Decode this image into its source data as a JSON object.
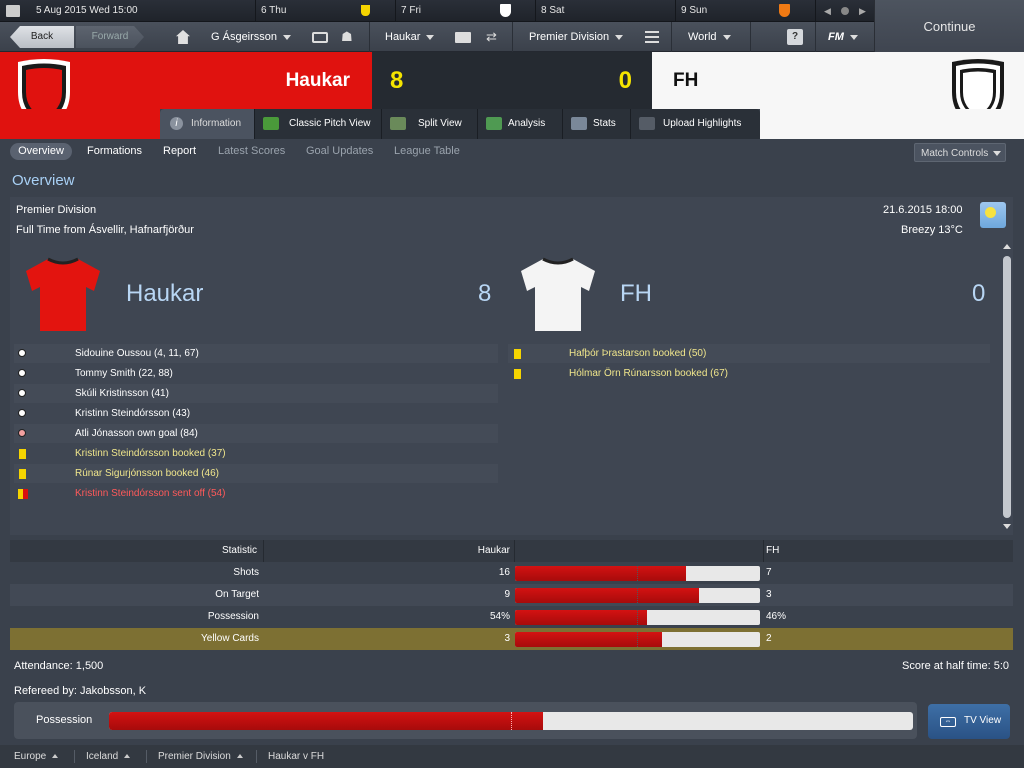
{
  "calendar": {
    "today": "5 Aug 2015  Wed  15:00",
    "days": [
      "6  Thu",
      "7  Fri",
      "8  Sat",
      "9  Sun"
    ]
  },
  "continue_label": "Continue",
  "nav": {
    "back": "Back",
    "forward": "Forward",
    "manager": "G Ásgeirsson",
    "club": "Haukar",
    "competition": "Premier Division",
    "world": "World",
    "help": "?",
    "fm": "FM"
  },
  "match": {
    "home_team": "Haukar",
    "away_team": "FH",
    "home_score": "8",
    "away_score": "0"
  },
  "tabs": [
    "Information",
    "Classic Pitch View",
    "Split View",
    "Analysis",
    "Stats",
    "Upload Highlights"
  ],
  "subtabs": [
    "Overview",
    "Formations",
    "Report",
    "Latest Scores",
    "Goal Updates",
    "League Table"
  ],
  "match_controls": "Match Controls",
  "overview": {
    "title": "Overview",
    "competition": "Premier Division",
    "venue": "Full Time from Ásvellir, Hafnarfjörður",
    "datetime": "21.6.2015 18:00",
    "weather": "Breezy 13°C"
  },
  "home_events": [
    {
      "type": "goal",
      "text": "Sidouine Oussou (4, 11, 67)"
    },
    {
      "type": "goal",
      "text": "Tommy Smith (22, 88)"
    },
    {
      "type": "goal",
      "text": "Skúli Kristinsson (41)"
    },
    {
      "type": "goal",
      "text": "Kristinn Steindórsson (43)"
    },
    {
      "type": "own_goal",
      "text": "Atli Jónasson own goal (84)"
    },
    {
      "type": "yellow",
      "text": "Kristinn Steindórsson booked (37)"
    },
    {
      "type": "yellow",
      "text": "Rúnar Sigurjónsson booked (46)"
    },
    {
      "type": "red",
      "text": "Kristinn Steindórsson sent off (54)"
    }
  ],
  "away_events": [
    {
      "type": "yellow",
      "text": "Hafþór Þrastarson booked (50)"
    },
    {
      "type": "yellow",
      "text": "Hólmar Örn Rúnarsson booked (67)"
    }
  ],
  "stats": {
    "header": {
      "label": "Statistic",
      "home": "Haukar",
      "away": "FH"
    },
    "rows": [
      {
        "label": "Shots",
        "home": "16",
        "away": "7",
        "home_share": 0.696
      },
      {
        "label": "On Target",
        "home": "9",
        "away": "3",
        "home_share": 0.75
      },
      {
        "label": "Possession",
        "home": "54%",
        "away": "46%",
        "home_share": 0.54
      },
      {
        "label": "Yellow Cards",
        "home": "3",
        "away": "2",
        "home_share": 0.6
      }
    ]
  },
  "attendance": "Attendance: 1,500",
  "half_time": "Score at half time: 5:0",
  "referee": "Refereed by: Jakobsson, K",
  "possession_bar": {
    "label": "Possession",
    "home_share": 0.54
  },
  "tv_view": "TV View",
  "breadcrumbs": [
    "Europe",
    "Iceland",
    "Premier Division",
    "Haukar v FH"
  ],
  "colors": {
    "home": "#e0120f",
    "away": "#f7f7f7",
    "highlight_row": "#7d7033",
    "yellow_text": "#f0e68c",
    "red_text": "#ff5a5a"
  }
}
